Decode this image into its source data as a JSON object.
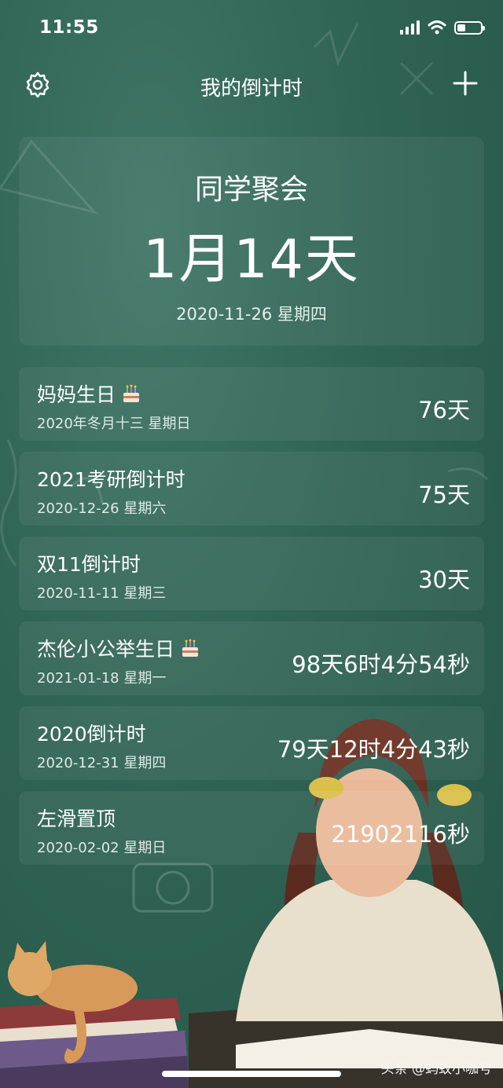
{
  "status_bar": {
    "time": "11:55",
    "battery_level": 0.35
  },
  "nav": {
    "title": "我的倒计时",
    "left_icon": "gear-icon",
    "right_icon": "plus-icon"
  },
  "hero": {
    "name": "同学聚会",
    "countdown": "1月14天",
    "date": "2020-11-26 星期四"
  },
  "events": [
    {
      "title": "妈妈生日",
      "has_cake": true,
      "date": "2020年冬月十三 星期日",
      "value": "76天"
    },
    {
      "title": "2021考研倒计时",
      "has_cake": false,
      "date": "2020-12-26 星期六",
      "value": "75天"
    },
    {
      "title": "双11倒计时",
      "has_cake": false,
      "date": "2020-11-11 星期三",
      "value": "30天"
    },
    {
      "title": "杰伦小公举生日",
      "has_cake": true,
      "date": "2021-01-18 星期一",
      "value": "98天6时4分54秒"
    },
    {
      "title": "2020倒计时",
      "has_cake": false,
      "date": "2020-12-31 星期四",
      "value": "79天12时4分43秒"
    },
    {
      "title": "左滑置顶",
      "has_cake": false,
      "date": "2020-02-02 星期日",
      "value": "21902116秒"
    }
  ],
  "watermark": "头条 @蚂蚁小咖号",
  "colors": {
    "background": "#2f6353",
    "card": "#3b6c5e",
    "text": "#ffffff"
  }
}
